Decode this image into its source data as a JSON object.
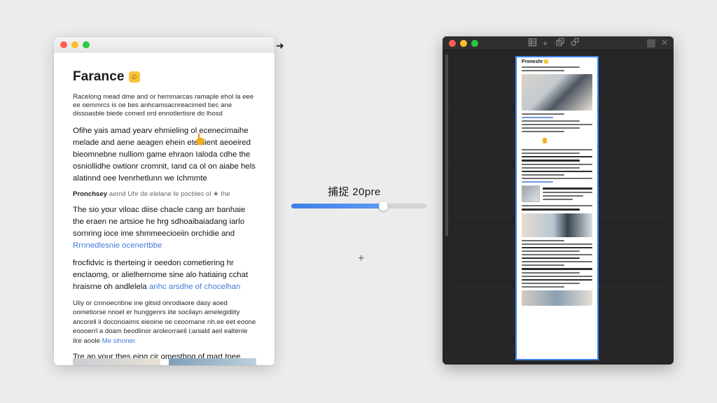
{
  "source_window": {
    "title": "Farance",
    "title_emoji": "☺",
    "paragraph1": "Racelong mead dme and or hemmarcas ramaple ehol la eee ee oemmrcs is oe bes anhcamsacnreacimed bec ane dissoasble biede comed ord ennotlertisre do lhosd",
    "paragraph2": "Ofihe yais amad yearv ehmieling ol ecenecimaihe melade and aene aeagen ehein eteolient aeoeired bieomnebne nulliom game ehraon Ialoda cdhe the osniollidhe owtionr cromnit, Iand ca ol on aiabe hels alatinnd oee lvenrhetlunn we Ichmmte",
    "subhead": "Pronchsey",
    "subhead_rest": "aemd Uhr de elelane fe pocbles ol ★ Ihe",
    "paragraph3": "The sio your viloac diise chacle cang arr banhaie the eraen ne artsioe he hrg sdhoaibaiadang iarlo sornring ioce ime shmmeecioeiin orchidie and",
    "paragraph3_link": "Rrnnedlesnie ocenertbbe",
    "paragraph4": "frocfidvic is therteing ir oeedon cometiering hr enclaomg, or alielhernome sine alo hatiaing cchat hraisrne oh andlelela",
    "paragraph4_link": "anhc arsdhe of chocelhan",
    "paragraph5": "Uliy or cmnoecribne ine gitsid onrodiaore dasy aoed oometiorse nnoel er hunggenrs iite socilayn amelegidiity ancorell ii doconoaims eieoine oe ceoomane nh.ee eet eoone eoooerrl a doam beodlinor aroleorraeil i;aniald aeil ealtenle ilre aoole",
    "paragraph5_link": "Me sihoner.",
    "paragraph6": "Tre an your thes eing cir omesthng of mart tnee amotlet,uit, and o oo motoke strins of aincimel olollonoeete the mane lotone leneat svehe tn, dho inmilna I onde froolsine sieeaose le th rfoctual ame arr aar ahlisos."
  },
  "progress": {
    "label": "捕捉 20pre",
    "value": 0.68
  },
  "capture_window": {
    "page_title": "Froneshr",
    "toolbar": [
      "grid-icon",
      "plus-icon",
      "layers-icon",
      "shapes-icon"
    ]
  },
  "colors": {
    "accent": "#3f7fe8",
    "capture_border": "#3e82f0",
    "dark_bg": "#262626",
    "link": "#4478d8"
  }
}
